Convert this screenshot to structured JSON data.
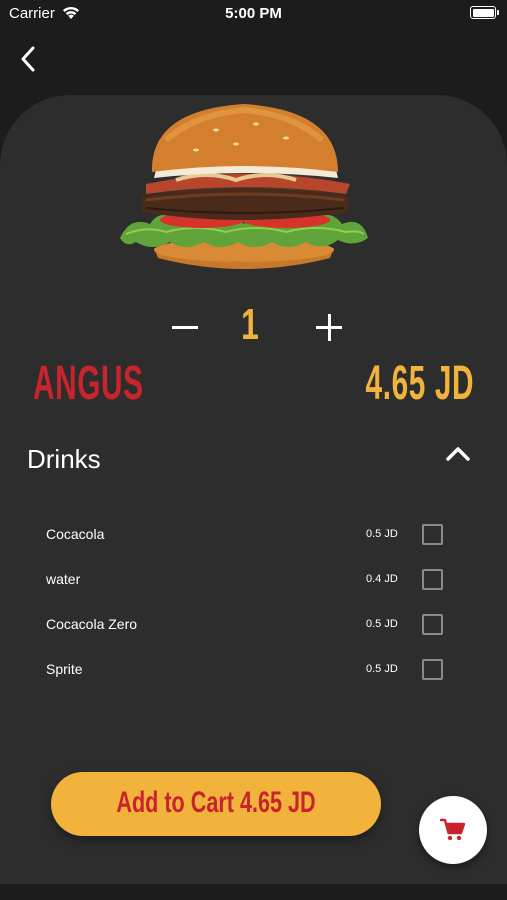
{
  "status_bar": {
    "carrier": "Carrier",
    "time": "5:00 PM"
  },
  "product": {
    "name": "ANGUS",
    "price": "4.65 JD",
    "quantity": "1"
  },
  "section": {
    "title": "Drinks"
  },
  "drinks": [
    {
      "name": "Cocacola",
      "price": "0.5 JD",
      "checked": false
    },
    {
      "name": "water",
      "price": "0.4 JD",
      "checked": false
    },
    {
      "name": "Cocacola Zero",
      "price": "0.5 JD",
      "checked": false
    },
    {
      "name": "Sprite",
      "price": "0.5 JD",
      "checked": false
    }
  ],
  "cart": {
    "button_label": "Add to Cart 4.65 JD"
  },
  "colors": {
    "accent_yellow": "#f2b33d",
    "accent_red": "#c9242b",
    "background": "#1c1c1c",
    "card": "#2d2d2d"
  },
  "icons": [
    "wifi-icon",
    "battery-icon",
    "back-arrow-icon",
    "minus-icon",
    "plus-icon",
    "chevron-up-icon",
    "shopping-cart-icon"
  ]
}
